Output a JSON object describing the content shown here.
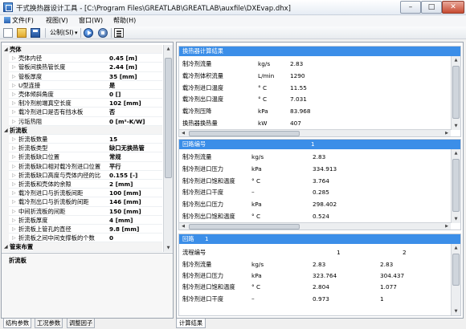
{
  "window": {
    "title": "干式换热器设计工具 - [C:\\Program Files\\GREATLAB\\GREATLAB\\auxfile\\DXEvap.dhx]",
    "min_glyph": "–",
    "max_glyph": "□",
    "close_glyph": "✕"
  },
  "menu": {
    "file": "文件(F)",
    "view": "视图(V)",
    "window": "窗口(W)",
    "help": "帮助(H)"
  },
  "toolbar": {
    "units": "公制(SI)",
    "units_arrow": "▾"
  },
  "property_grid": {
    "rows": [
      {
        "type": "category",
        "label": "壳体",
        "value": ""
      },
      {
        "type": "item",
        "label": "壳体内径",
        "value": "0.45 [m]"
      },
      {
        "type": "item",
        "label": "管板间换热管长度",
        "value": "2.44 [m]"
      },
      {
        "type": "item",
        "label": "管板厚度",
        "value": "35 [mm]"
      },
      {
        "type": "item",
        "label": "U型连接",
        "value": "是"
      },
      {
        "type": "item",
        "label": "壳体倾斜角度",
        "value": "0 []"
      },
      {
        "type": "item",
        "label": "制冷剂前端真空长度",
        "value": "102 [mm]"
      },
      {
        "type": "item",
        "label": "载冷剂进口是否有挡水板",
        "value": "否"
      },
      {
        "type": "item",
        "label": "污垢热阻",
        "value": "0 [m²-K/W]"
      },
      {
        "type": "category",
        "label": "折流板",
        "value": ""
      },
      {
        "type": "item",
        "label": "折流板数量",
        "value": "15"
      },
      {
        "type": "item",
        "label": "折流板类型",
        "value": "缺口无换热管"
      },
      {
        "type": "item",
        "label": "折流板缺口位置",
        "value": "常规"
      },
      {
        "type": "item",
        "label": "折流板缺口相对载冷剂进口位置",
        "value": "平行"
      },
      {
        "type": "item",
        "label": "折流板缺口高度与壳体内径的比",
        "value": "0.155 [-]"
      },
      {
        "type": "item",
        "label": "折流板和壳体的余隙",
        "value": "2 [mm]"
      },
      {
        "type": "item",
        "label": "载冷剂进口与折流板间距",
        "value": "100 [mm]"
      },
      {
        "type": "item",
        "label": "载冷剂出口与折流板的间距",
        "value": "146 [mm]"
      },
      {
        "type": "item",
        "label": "中间折流板的间距",
        "value": "150 [mm]"
      },
      {
        "type": "item",
        "label": "折流板厚度",
        "value": "4 [mm]"
      },
      {
        "type": "item",
        "label": "折流板上管孔的直径",
        "value": "9.8 [mm]"
      },
      {
        "type": "item",
        "label": "折流板之间中间支撑板的个数",
        "value": "0"
      },
      {
        "type": "category",
        "label": "管束布置",
        "value": ""
      }
    ]
  },
  "description_panel": {
    "title": "折流板"
  },
  "left_tabs": [
    "结构参数",
    "工况参数",
    "调整因子"
  ],
  "right_tabs": [
    "计算结果"
  ],
  "results": {
    "heat_exchanger": {
      "header": "换热器计算结果",
      "rows": [
        {
          "label": "制冷剂流量",
          "unit": "kg/s",
          "value": "2.83"
        },
        {
          "label": "载冷剂体积流量",
          "unit": "L/min",
          "value": "1290"
        },
        {
          "label": "载冷剂进口温度",
          "unit": "° C",
          "value": "11.55"
        },
        {
          "label": "载冷剂出口温度",
          "unit": "° C",
          "value": "7.031"
        },
        {
          "label": "载冷剂压降",
          "unit": "kPa",
          "value": "83.968"
        },
        {
          "label": "换热器换热量",
          "unit": "kW",
          "value": "407"
        }
      ]
    },
    "circuit_number": {
      "header": "回路编号",
      "number": "1",
      "rows": [
        {
          "label": "制冷剂流量",
          "unit": "kg/s",
          "value": "2.83"
        },
        {
          "label": "制冷剂进口压力",
          "unit": "kPa",
          "value": "334.913"
        },
        {
          "label": "制冷剂进口饱和温度",
          "unit": "° C",
          "value": "3.764"
        },
        {
          "label": "制冷剂进口干度",
          "unit": "–",
          "value": "0.285"
        },
        {
          "label": "制冷剂出口压力",
          "unit": "kPa",
          "value": "298.402"
        },
        {
          "label": "制冷剂出口饱和温度",
          "unit": "° C",
          "value": "0.524"
        }
      ]
    },
    "circuit": {
      "header": "回路",
      "number": "1",
      "flow_label": "流程编号",
      "flow_numbers": [
        "1",
        "2"
      ],
      "rows": [
        {
          "label": "制冷剂流量",
          "unit": "kg/s",
          "v1": "2.83",
          "v2": "2.83"
        },
        {
          "label": "制冷剂进口压力",
          "unit": "kPa",
          "v1": "323.764",
          "v2": "304.437"
        },
        {
          "label": "制冷剂进口饱和温度",
          "unit": "° C",
          "v1": "2.804",
          "v2": "1.077"
        },
        {
          "label": "制冷剂进口干度",
          "unit": "–",
          "v1": "0.973",
          "v2": "1"
        }
      ]
    }
  }
}
